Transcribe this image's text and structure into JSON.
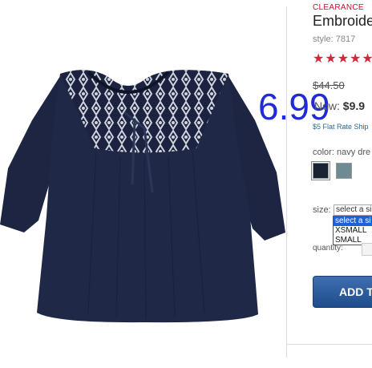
{
  "overlay": {
    "price": "6.99"
  },
  "product": {
    "badge": "CLEARANCE",
    "title": "Embroide",
    "style": "style: 7817",
    "rating_stars": "★★★★★",
    "original_price": "$44.50",
    "now_label": "Now:",
    "now_price": "$9.9",
    "shipping": "$5 Flat Rate Ship"
  },
  "color": {
    "label": "color: navy dre",
    "swatches": [
      {
        "name": "navy",
        "hex": "#1a2236"
      },
      {
        "name": "gray",
        "hex": "#6f8a92"
      }
    ]
  },
  "size": {
    "label": "size:",
    "selected": "select a si",
    "options": [
      "select a si",
      "XSMALL",
      "SMALL"
    ]
  },
  "quantity": {
    "label": "quantity:"
  },
  "add_to_bag": {
    "label": "ADD T"
  },
  "colors": {
    "accent": "#c8102e",
    "overlay": "#1f2bd6",
    "button": "#2a5a9c"
  }
}
